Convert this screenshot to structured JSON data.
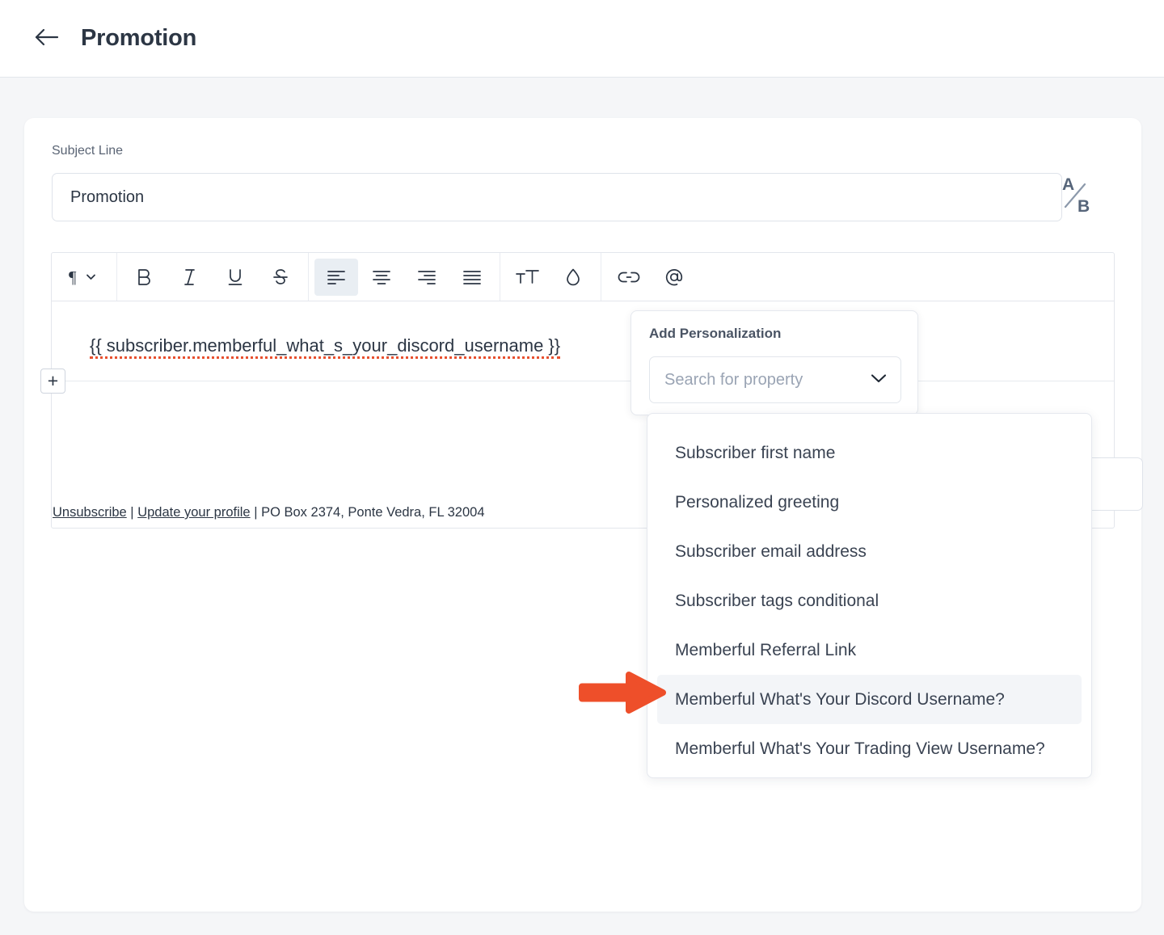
{
  "header": {
    "back_icon": "arrow-left-icon",
    "title": "Promotion"
  },
  "subject": {
    "label": "Subject Line",
    "value": "Promotion",
    "placeholder": "Subject Line",
    "ab_test_top": "A",
    "ab_test_bottom": "B"
  },
  "toolbar": {
    "items": [
      {
        "name": "paragraph-style-dropdown",
        "icon": "pilcrow-icon",
        "active": false
      },
      {
        "name": "bold-button",
        "icon": "bold-icon",
        "active": false
      },
      {
        "name": "italic-button",
        "icon": "italic-icon",
        "active": false
      },
      {
        "name": "underline-button",
        "icon": "underline-icon",
        "active": false
      },
      {
        "name": "strikethrough-button",
        "icon": "strikethrough-icon",
        "active": false
      },
      {
        "name": "align-left-button",
        "icon": "align-left-icon",
        "active": true
      },
      {
        "name": "align-center-button",
        "icon": "align-center-icon",
        "active": false
      },
      {
        "name": "align-right-button",
        "icon": "align-right-icon",
        "active": false
      },
      {
        "name": "align-justify-button",
        "icon": "align-justify-icon",
        "active": false
      },
      {
        "name": "font-size-button",
        "icon": "text-size-icon",
        "active": false
      },
      {
        "name": "text-color-button",
        "icon": "droplet-icon",
        "active": false
      },
      {
        "name": "insert-link-button",
        "icon": "link-icon",
        "active": false
      },
      {
        "name": "mention-button",
        "icon": "at-sign-icon",
        "active": false
      }
    ]
  },
  "editor": {
    "content": "{{ subscriber.memberful_what_s_your_discord_username }}",
    "add_block_label": "+",
    "footer": {
      "unsubscribe": "Unsubscribe",
      "separator_1": "|",
      "update_profile": "Update your profile",
      "separator_2": "|",
      "address": "PO Box 2374, Ponte Vedra, FL 32004"
    }
  },
  "personalization": {
    "title": "Add Personalization",
    "search_placeholder": "Search for property",
    "search_value": "",
    "chevron_icon": "chevron-down-icon",
    "options": [
      {
        "label": "Subscriber first name",
        "highlighted": false
      },
      {
        "label": "Personalized greeting",
        "highlighted": false
      },
      {
        "label": "Subscriber email address",
        "highlighted": false
      },
      {
        "label": "Subscriber tags conditional",
        "highlighted": false
      },
      {
        "label": "Memberful Referral Link",
        "highlighted": false
      },
      {
        "label": "Memberful What's Your Discord Username?",
        "highlighted": true
      },
      {
        "label": "Memberful What's Your Trading View Username?",
        "highlighted": false
      }
    ]
  },
  "annotation": {
    "arrow_color": "#ee4f2a",
    "points_at": "Memberful What's Your Discord Username?"
  },
  "colors": {
    "page_background": "#f5f6f8",
    "card_background": "#ffffff",
    "text_primary": "#2c3644",
    "text_muted": "#5a6474",
    "border": "#e3e6ec",
    "highlight_row": "#f3f5f8",
    "accent_orange": "#ee4f2a",
    "spellcheck_red": "#e8502f"
  }
}
